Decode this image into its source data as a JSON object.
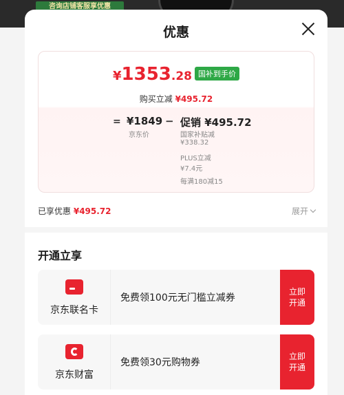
{
  "background": {
    "banner_text": "咨询店铺客服享优惠"
  },
  "header": {
    "title": "优惠"
  },
  "breakdown": {
    "final_price": {
      "symbol": "¥",
      "integer": "1353",
      "decimal": ".28"
    },
    "final_tag": "国补到手价",
    "reduce_label": "购买立减",
    "reduce_amount": "¥495.72",
    "equals": "=",
    "base_price": "¥1849",
    "base_label": "京东价",
    "minus": "−",
    "promo_title": "促销 ¥495.72",
    "promo_items": [
      {
        "name": "国家补贴减",
        "amount": "¥338.32"
      },
      {
        "name": "PLUS立减",
        "amount": "¥7.4元"
      },
      {
        "name": "每满180减15"
      }
    ]
  },
  "summary": {
    "label": "已享优惠",
    "amount": "¥495.72",
    "expand_label": "展开"
  },
  "open_section": {
    "title": "开通立享",
    "items": [
      {
        "name": "京东联名卡",
        "icon": "credit-card-icon",
        "offer": "免费领100元无门槛立减券",
        "cta_line1": "立即",
        "cta_line2": "开通"
      },
      {
        "name": "京东财富",
        "icon": "wallet-icon",
        "offer": "免费领30元购物券",
        "cta_line1": "立即",
        "cta_line2": "开通"
      }
    ]
  },
  "colors": {
    "accent": "#e8232f",
    "tag_green": "#2ea846"
  }
}
